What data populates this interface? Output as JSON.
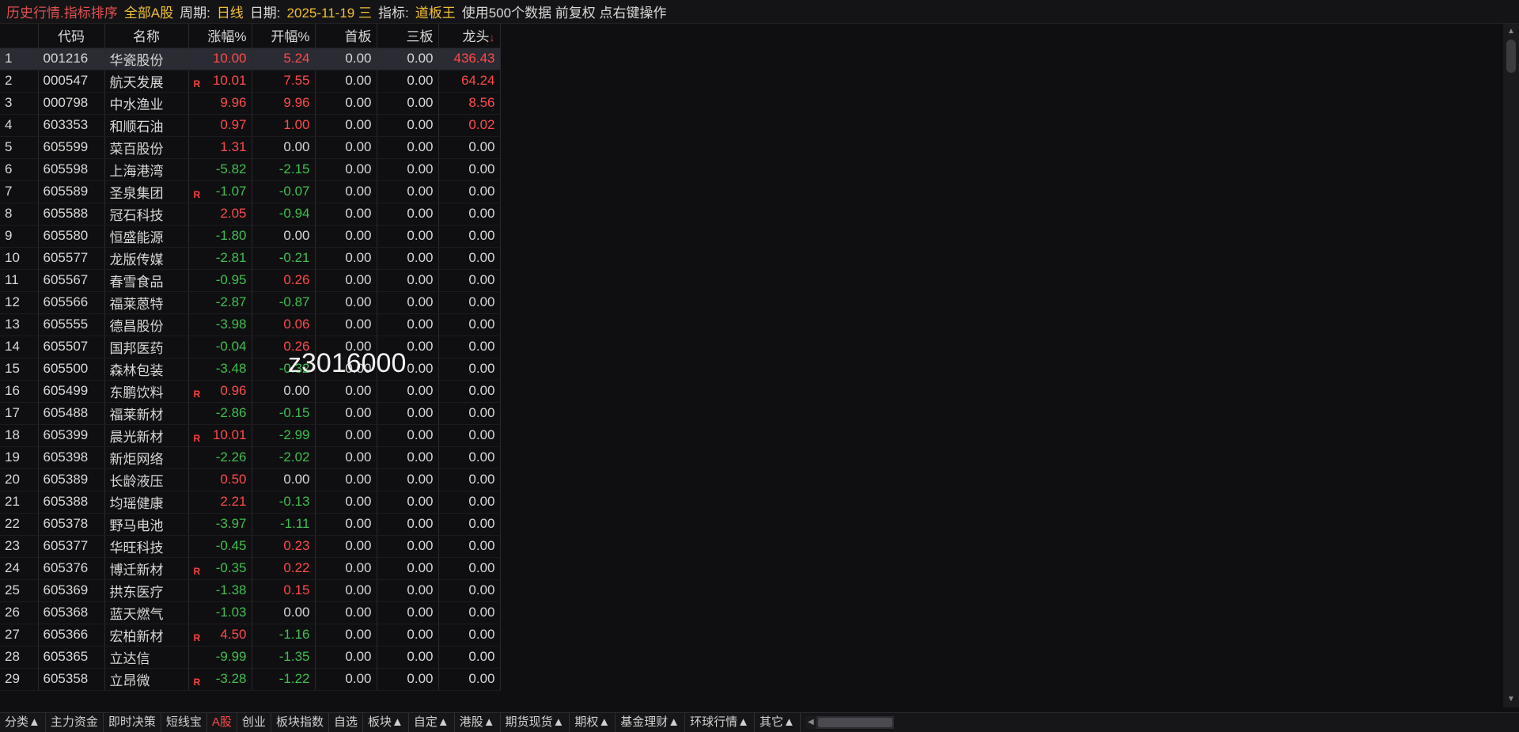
{
  "topbar": {
    "title": "历史行情.指标排序",
    "market": "全部A股",
    "period_label": "周期:",
    "period_value": "日线",
    "date_label": "日期:",
    "date_value": "2025-11-19 三",
    "indicator_label": "指标:",
    "indicator_value": "道板王",
    "info": "使用500个数据 前复权 点右键操作"
  },
  "columns": [
    "",
    "代码",
    "名称",
    "涨幅%",
    "开幅%",
    "首板",
    "三板",
    "龙头"
  ],
  "sort_indicator": "↓",
  "rows": [
    {
      "idx": "1",
      "code": "001216",
      "name": "华瓷股份",
      "tag": "",
      "zf": "10.00",
      "kf": "5.24",
      "sb": "0.00",
      "tb": "0.00",
      "lt": "436.43"
    },
    {
      "idx": "2",
      "code": "000547",
      "name": "航天发展",
      "tag": "R",
      "zf": "10.01",
      "kf": "7.55",
      "sb": "0.00",
      "tb": "0.00",
      "lt": "64.24"
    },
    {
      "idx": "3",
      "code": "000798",
      "name": "中水渔业",
      "tag": "",
      "zf": "9.96",
      "kf": "9.96",
      "sb": "0.00",
      "tb": "0.00",
      "lt": "8.56"
    },
    {
      "idx": "4",
      "code": "603353",
      "name": "和顺石油",
      "tag": "",
      "zf": "0.97",
      "kf": "1.00",
      "sb": "0.00",
      "tb": "0.00",
      "lt": "0.02"
    },
    {
      "idx": "5",
      "code": "605599",
      "name": "菜百股份",
      "tag": "",
      "zf": "1.31",
      "kf": "0.00",
      "sb": "0.00",
      "tb": "0.00",
      "lt": "0.00"
    },
    {
      "idx": "6",
      "code": "605598",
      "name": "上海港湾",
      "tag": "",
      "zf": "-5.82",
      "kf": "-2.15",
      "sb": "0.00",
      "tb": "0.00",
      "lt": "0.00"
    },
    {
      "idx": "7",
      "code": "605589",
      "name": "圣泉集团",
      "tag": "R",
      "zf": "-1.07",
      "kf": "-0.07",
      "sb": "0.00",
      "tb": "0.00",
      "lt": "0.00"
    },
    {
      "idx": "8",
      "code": "605588",
      "name": "冠石科技",
      "tag": "",
      "zf": "2.05",
      "kf": "-0.94",
      "sb": "0.00",
      "tb": "0.00",
      "lt": "0.00"
    },
    {
      "idx": "9",
      "code": "605580",
      "name": "恒盛能源",
      "tag": "",
      "zf": "-1.80",
      "kf": "0.00",
      "sb": "0.00",
      "tb": "0.00",
      "lt": "0.00"
    },
    {
      "idx": "10",
      "code": "605577",
      "name": "龙版传媒",
      "tag": "",
      "zf": "-2.81",
      "kf": "-0.21",
      "sb": "0.00",
      "tb": "0.00",
      "lt": "0.00"
    },
    {
      "idx": "11",
      "code": "605567",
      "name": "春雪食品",
      "tag": "",
      "zf": "-0.95",
      "kf": "0.26",
      "sb": "0.00",
      "tb": "0.00",
      "lt": "0.00"
    },
    {
      "idx": "12",
      "code": "605566",
      "name": "福莱蒽特",
      "tag": "",
      "zf": "-2.87",
      "kf": "-0.87",
      "sb": "0.00",
      "tb": "0.00",
      "lt": "0.00"
    },
    {
      "idx": "13",
      "code": "605555",
      "name": "德昌股份",
      "tag": "",
      "zf": "-3.98",
      "kf": "0.06",
      "sb": "0.00",
      "tb": "0.00",
      "lt": "0.00"
    },
    {
      "idx": "14",
      "code": "605507",
      "name": "国邦医药",
      "tag": "",
      "zf": "-0.04",
      "kf": "0.26",
      "sb": "0.00",
      "tb": "0.00",
      "lt": "0.00"
    },
    {
      "idx": "15",
      "code": "605500",
      "name": "森林包装",
      "tag": "",
      "zf": "-3.48",
      "kf": "-0.32",
      "sb": "0.00",
      "tb": "0.00",
      "lt": "0.00"
    },
    {
      "idx": "16",
      "code": "605499",
      "name": "东鹏饮料",
      "tag": "R",
      "zf": "0.96",
      "kf": "0.00",
      "sb": "0.00",
      "tb": "0.00",
      "lt": "0.00"
    },
    {
      "idx": "17",
      "code": "605488",
      "name": "福莱新材",
      "tag": "",
      "zf": "-2.86",
      "kf": "-0.15",
      "sb": "0.00",
      "tb": "0.00",
      "lt": "0.00"
    },
    {
      "idx": "18",
      "code": "605399",
      "name": "晨光新材",
      "tag": "R",
      "zf": "10.01",
      "kf": "-2.99",
      "sb": "0.00",
      "tb": "0.00",
      "lt": "0.00"
    },
    {
      "idx": "19",
      "code": "605398",
      "name": "新炬网络",
      "tag": "",
      "zf": "-2.26",
      "kf": "-2.02",
      "sb": "0.00",
      "tb": "0.00",
      "lt": "0.00"
    },
    {
      "idx": "20",
      "code": "605389",
      "name": "长龄液压",
      "tag": "",
      "zf": "0.50",
      "kf": "0.00",
      "sb": "0.00",
      "tb": "0.00",
      "lt": "0.00"
    },
    {
      "idx": "21",
      "code": "605388",
      "name": "均瑶健康",
      "tag": "",
      "zf": "2.21",
      "kf": "-0.13",
      "sb": "0.00",
      "tb": "0.00",
      "lt": "0.00"
    },
    {
      "idx": "22",
      "code": "605378",
      "name": "野马电池",
      "tag": "",
      "zf": "-3.97",
      "kf": "-1.11",
      "sb": "0.00",
      "tb": "0.00",
      "lt": "0.00"
    },
    {
      "idx": "23",
      "code": "605377",
      "name": "华旺科技",
      "tag": "",
      "zf": "-0.45",
      "kf": "0.23",
      "sb": "0.00",
      "tb": "0.00",
      "lt": "0.00"
    },
    {
      "idx": "24",
      "code": "605376",
      "name": "博迁新材",
      "tag": "R",
      "zf": "-0.35",
      "kf": "0.22",
      "sb": "0.00",
      "tb": "0.00",
      "lt": "0.00"
    },
    {
      "idx": "25",
      "code": "605369",
      "name": "拱东医疗",
      "tag": "",
      "zf": "-1.38",
      "kf": "0.15",
      "sb": "0.00",
      "tb": "0.00",
      "lt": "0.00"
    },
    {
      "idx": "26",
      "code": "605368",
      "name": "蓝天燃气",
      "tag": "",
      "zf": "-1.03",
      "kf": "0.00",
      "sb": "0.00",
      "tb": "0.00",
      "lt": "0.00"
    },
    {
      "idx": "27",
      "code": "605366",
      "name": "宏柏新材",
      "tag": "R",
      "zf": "4.50",
      "kf": "-1.16",
      "sb": "0.00",
      "tb": "0.00",
      "lt": "0.00"
    },
    {
      "idx": "28",
      "code": "605365",
      "name": "立达信",
      "tag": "",
      "zf": "-9.99",
      "kf": "-1.35",
      "sb": "0.00",
      "tb": "0.00",
      "lt": "0.00"
    },
    {
      "idx": "29",
      "code": "605358",
      "name": "立昂微",
      "tag": "R",
      "zf": "-3.28",
      "kf": "-1.22",
      "sb": "0.00",
      "tb": "0.00",
      "lt": "0.00"
    }
  ],
  "watermark": "z3016000",
  "bottom_tabs": [
    "分类▲",
    "主力资金",
    "即时决策",
    "短线宝",
    "A股",
    "创业",
    "板块指数",
    "自选",
    "板块▲",
    "自定▲",
    "港股▲",
    "期货现货▲",
    "期权▲",
    "基金理财▲",
    "环球行情▲",
    "其它▲"
  ],
  "active_tab": "A股",
  "colors": {
    "up": "#ff4a4a",
    "down": "#3fbf4f",
    "accent": "#f0c030",
    "bg": "#0f0f11"
  }
}
